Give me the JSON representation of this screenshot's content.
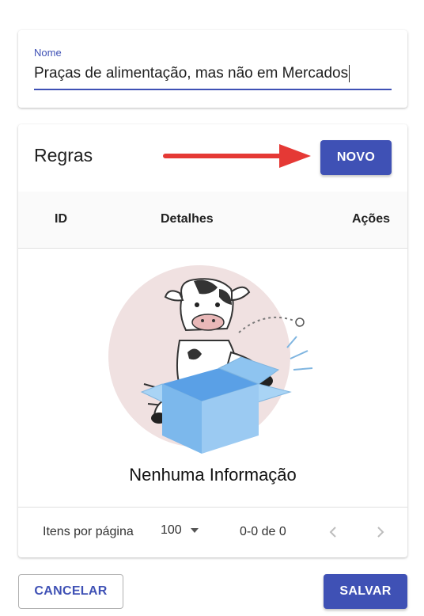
{
  "form": {
    "name_label": "Nome",
    "name_value": "Praças de alimentação, mas não em Mercados"
  },
  "rules": {
    "title": "Regras",
    "new_button": "NOVO",
    "columns": [
      "ID",
      "Detalhes",
      "Ações"
    ],
    "empty_text": "Nenhuma Informação"
  },
  "pagination": {
    "items_per_page_label": "Itens por página",
    "items_per_page_value": "100",
    "range_text": "0-0 de 0"
  },
  "actions": {
    "cancel_label": "CANCELAR",
    "save_label": "SALVAR"
  },
  "colors": {
    "primary": "#3f51b5",
    "arrow": "#e53935"
  }
}
